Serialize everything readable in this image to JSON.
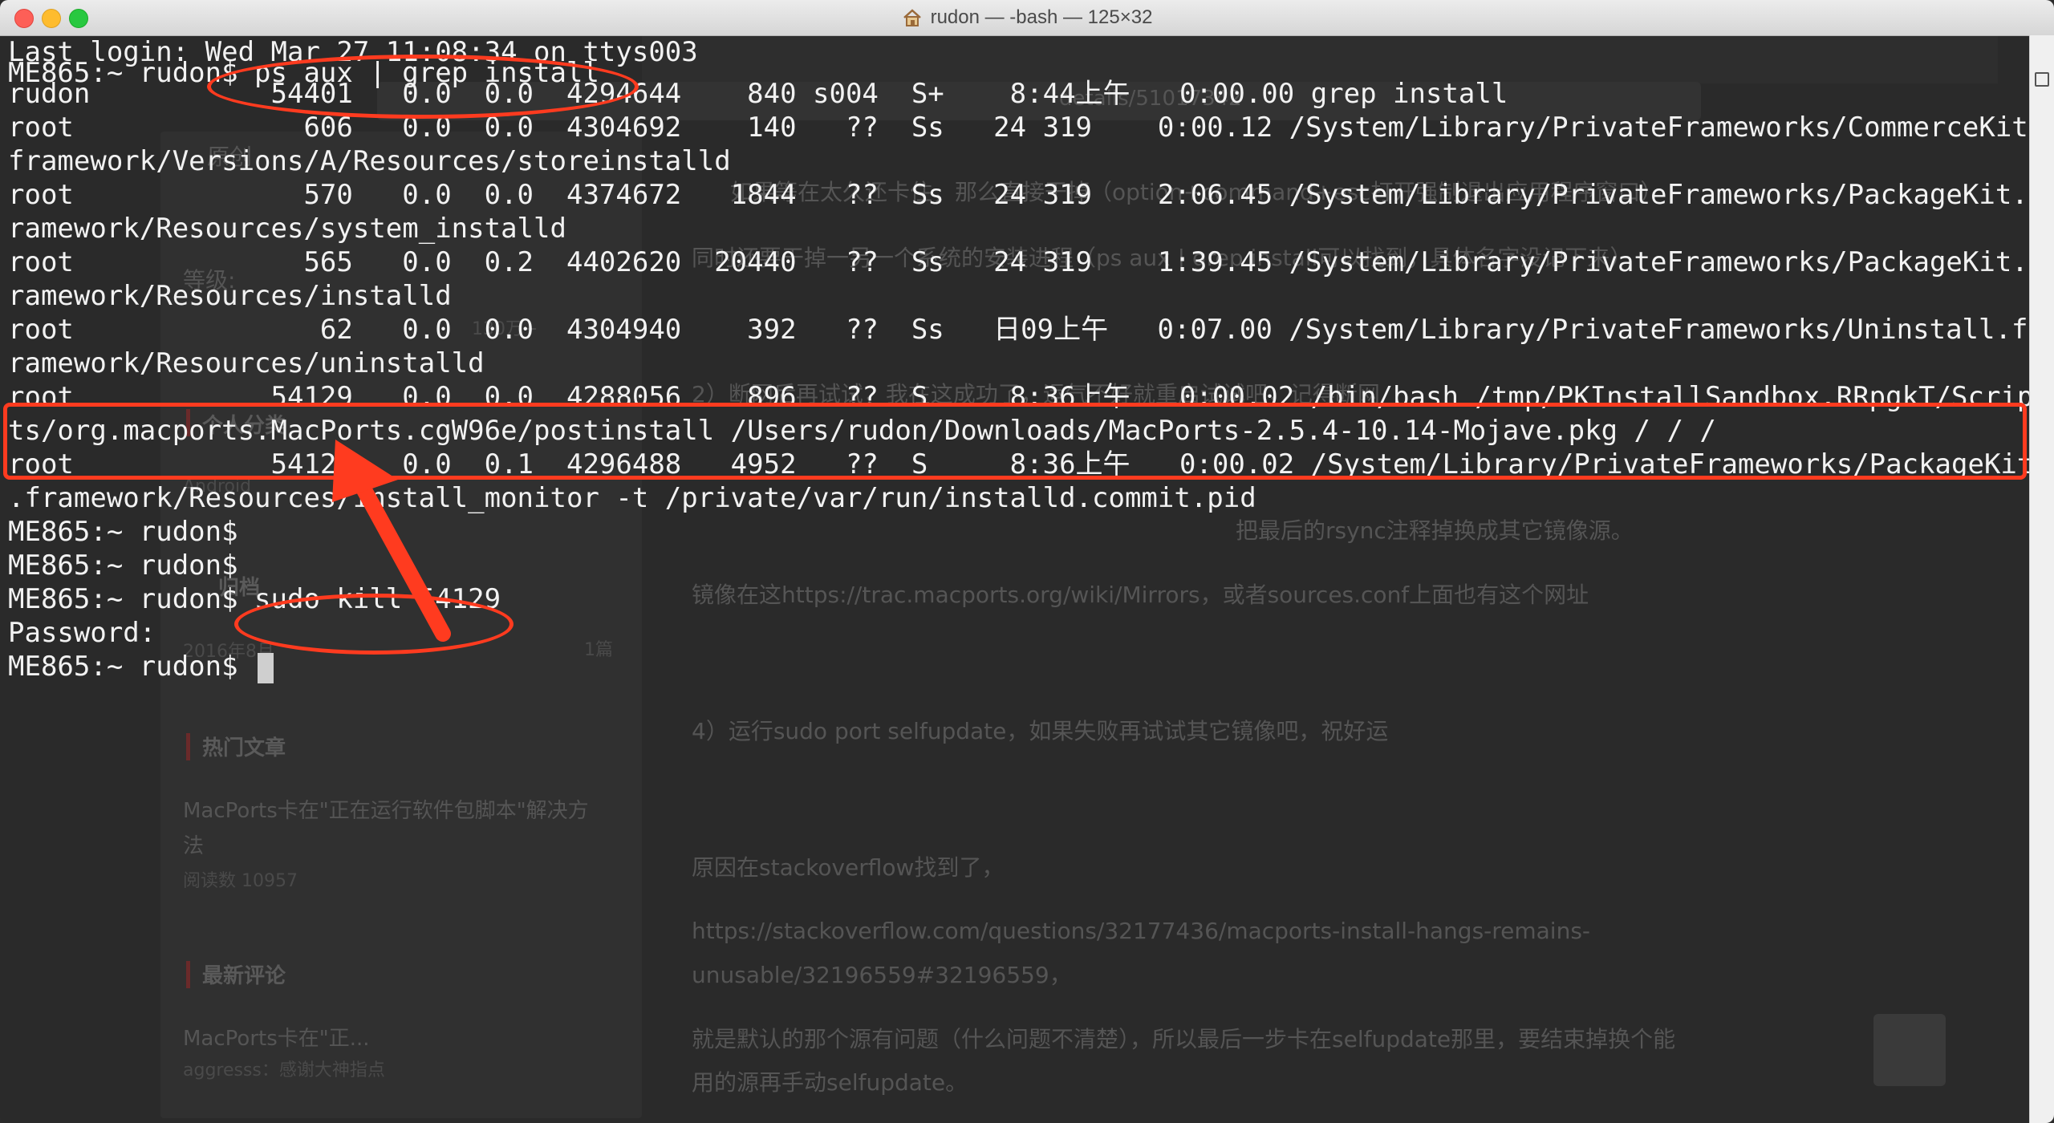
{
  "window": {
    "title": "rudon — -bash — 125×32"
  },
  "terminal": {
    "lines": [
      "Last login: Wed Mar 27 11:08:34 on ttys003",
      "ME865:~ rudon$ ps aux | grep install",
      "rudon           54401   0.0  0.0  4294644    840 s004  S+    8:44上午   0:00.00 grep install",
      "root              606   0.0  0.0  4304692    140   ??  Ss   24 319    0:00.12 /System/Library/PrivateFrameworks/CommerceKit.",
      "framework/Versions/A/Resources/storeinstalld",
      "root              570   0.0  0.0  4374672   1844   ??  Ss   24 319    2:06.45 /System/Library/PrivateFrameworks/PackageKit.f",
      "ramework/Resources/system_installd",
      "root              565   0.0  0.2  4402620  20440   ??  Ss   24 319    1:39.45 /System/Library/PrivateFrameworks/PackageKit.f",
      "ramework/Resources/installd",
      "root               62   0.0  0.0  4304940    392   ??  Ss   日09上午   0:07.00 /System/Library/PrivateFrameworks/Uninstall.f",
      "ramework/Resources/uninstalld",
      "root            54129   0.0  0.0  4288056    896   ??  S     8:36上午   0:00.02 /bin/bash /tmp/PKInstallSandbox.RRpgkT/Scrip",
      "ts/org.macports.MacPorts.cgW96e/postinstall /Users/rudon/Downloads/MacPorts-2.5.4-10.14-Mojave.pkg / / /",
      "root            54126   0.0  0.1  4296488   4952   ??  S     8:36上午   0:00.02 /System/Library/PrivateFrameworks/PackageKit",
      ".framework/Resources/install_monitor -t /private/var/run/installd.commit.pid",
      "ME865:~ rudon$",
      "ME865:~ rudon$",
      "ME865:~ rudon$ sudo kill 54129",
      "Password:",
      "ME865:~ rudon$ "
    ]
  },
  "background_page": {
    "texts": [
      "如果等在太久还卡住，那么直接干掉（option+command+esc打开强制退出应用程序窗口）",
      "同时还要干掉一另一个系统的安装进程（ps aux | grep install可以找到，具体名字没记下来）",
      "2）断网后再试试，我在这成功了，运气不好就重启试试吧，记得断网",
      "把最后的rsync注释掉换成其它镜像源。",
      "镜像在这https://trac.macports.org/wiki/Mirrors，或者sources.conf上面也有这个网址",
      "4）运行sudo port selfupdate，如果失败再试试其它镜像吧，祝好运",
      "原因在stackoverflow找到了，",
      "https://stackoverflow.com/questions/32177436/macports-install-hangs-remains-",
      "unusable/32196559#32196559，",
      "就是默认的那个源有问题（什么问题不清楚），所以最后一步卡在selfupdate那里，要结束掉换个能",
      "用的源再手动selfupdate。"
    ],
    "sidebar": {
      "original_label": "原创",
      "level_label": "等级:",
      "rank_value": "130万+",
      "personal_label": "个人分类",
      "android_label": "Android",
      "archive_label": "归档",
      "archive_date": "2016年8月",
      "archive_count": "1篇",
      "hot_title": "热门文章",
      "hot_item_title_1": "MacPorts卡在\"正在运行软件包脚本\"解决方",
      "hot_item_title_2": "法",
      "hot_item_reads": "阅读数 10957",
      "comments_title": "最新评论",
      "comment_item": "MacPorts卡在\"正...",
      "comment_author": "aggresss：感谢大神指点"
    },
    "url_fragment": "details/51017342"
  },
  "colors": {
    "annotation": "#ff3b1f",
    "terminal_text": "#f2f2f2",
    "terminal_bg": "#2a2a2a"
  }
}
